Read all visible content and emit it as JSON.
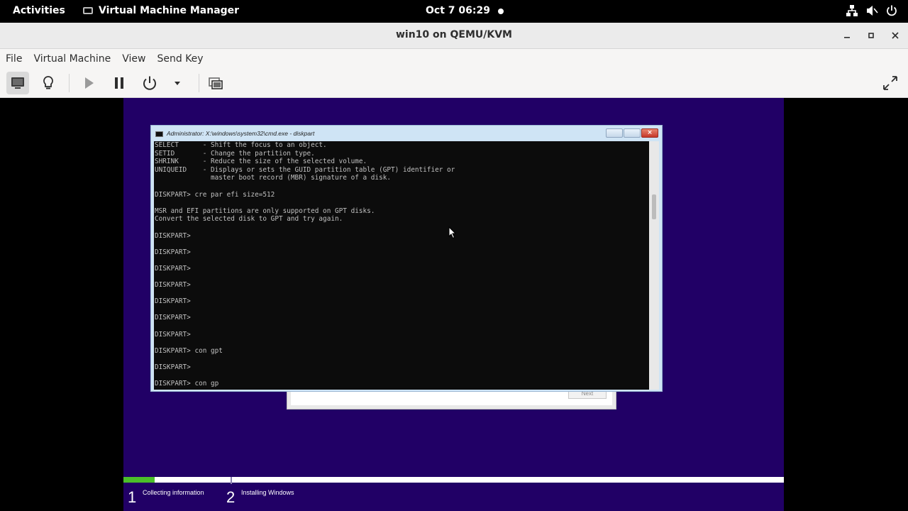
{
  "topbar": {
    "activities": "Activities",
    "app_name": "Virtual Machine Manager",
    "clock": "Oct 7  06:29"
  },
  "window": {
    "title": "win10 on QEMU/KVM"
  },
  "menu": {
    "file": "File",
    "virtual_machine": "Virtual Machine",
    "view": "View",
    "send_key": "Send Key"
  },
  "guest": {
    "cmd_title": "Administrator: X:\\windows\\system32\\cmd.exe - diskpart",
    "cmd_output": "SELECT      - Shift the focus to an object.\nSETID       - Change the partition type.\nSHRINK      - Reduce the size of the selected volume.\nUNIQUEID    - Displays or sets the GUID partition table (GPT) identifier or\n              master boot record (MBR) signature of a disk.\n\nDISKPART> cre par efi size=512\n\nMSR and EFI partitions are only supported on GPT disks.\nConvert the selected disk to GPT and try again.\n\nDISKPART>\n\nDISKPART>\n\nDISKPART>\n\nDISKPART>\n\nDISKPART>\n\nDISKPART>\n\nDISKPART>\n\nDISKPART> con gpt\n\nDISKPART>\n\nDISKPART> con gp",
    "setup_next_label": "Next",
    "progress_fraction": 0.047,
    "steps": [
      {
        "num": "1",
        "label": "Collecting information"
      },
      {
        "num": "2",
        "label": "Installing Windows"
      }
    ]
  },
  "colors": {
    "guest_background": "#210066",
    "progress_fill": "#4bbf2a"
  }
}
